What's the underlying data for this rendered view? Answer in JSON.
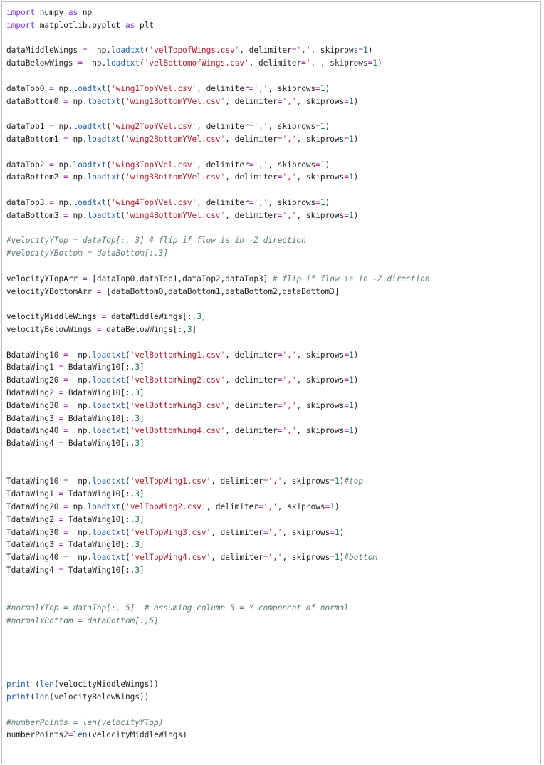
{
  "cell": {
    "lines": [
      "import numpy as np",
      "import matplotlib.pyplot as plt",
      "",
      "dataMiddleWings =  np.loadtxt('velTopofWings.csv', delimiter=',', skiprows=1)",
      "dataBelowWings =  np.loadtxt('velBottomofWings.csv', delimiter=',', skiprows=1)",
      "",
      "dataTop0 = np.loadtxt('wing1TopYVel.csv', delimiter=',', skiprows=1)",
      "dataBottom0 = np.loadtxt('wing1BottomYVel.csv', delimiter=',', skiprows=1)",
      "",
      "dataTop1 = np.loadtxt('wing2TopYVel.csv', delimiter=',', skiprows=1)",
      "dataBottom1 = np.loadtxt('wing2BottomYVel.csv', delimiter=',', skiprows=1)",
      "",
      "dataTop2 = np.loadtxt('wing3TopYVel.csv', delimiter=',', skiprows=1)",
      "dataBottom2 = np.loadtxt('wing3BottomYVel.csv', delimiter=',', skiprows=1)",
      "",
      "dataTop3 = np.loadtxt('wing4TopYVel.csv', delimiter=',', skiprows=1)",
      "dataBottom3 = np.loadtxt('wing4BottomYVel.csv', delimiter=',', skiprows=1)",
      "",
      "#velocityYTop = dataTop[:, 3] # flip if flow is in -Z direction",
      "#velocityYBottom = dataBottom[:,3]",
      "",
      "velocityYTopArr = [dataTop0,dataTop1,dataTop2,dataTop3] # flip if flow is in -Z direction",
      "velocityYBottomArr = [dataBottom0,dataBottom1,dataBottom2,dataBottom3]",
      "",
      "velocityMiddleWings = dataMiddleWings[:,3]",
      "velocityBelowWings = dataBelowWings[:,3]",
      "",
      "BdataWing10 =  np.loadtxt('velBottomWing1.csv', delimiter=',', skiprows=1)",
      "BdataWing1 = BdataWing10[:,3]",
      "BdataWing20 =  np.loadtxt('velBottomWing2.csv', delimiter=',', skiprows=1)",
      "BdataWing2 = BdataWing10[:,3]",
      "BdataWing30 =  np.loadtxt('velBottomWing3.csv', delimiter=',', skiprows=1)",
      "BdataWing3 = BdataWing10[:,3]",
      "BdataWing40 =  np.loadtxt('velBottomWing4.csv', delimiter=',', skiprows=1)",
      "BdataWing4 = BdataWing10[:,3]",
      "",
      "",
      "TdataWing10 =  np.loadtxt('velTopWing1.csv', delimiter=',', skiprows=1)#top",
      "TdataWing1 = TdataWing10[:,3]",
      "TdataWing20 = np.loadtxt('velTopWing2.csv', delimiter=',', skiprows=1)",
      "TdataWing2 = TdataWing10[:,3]",
      "TdataWing30 =  np.loadtxt('velTopWing3.csv', delimiter=',', skiprows=1)",
      "TdataWing3 = TdataWing10[:,3]",
      "TdataWing40 =  np.loadtxt('velTopWing4.csv', delimiter=',', skiprows=1)#bottom",
      "TdataWing4 = TdataWing10[:,3]",
      "",
      "",
      "#normalYTop = dataTop[:, 5]  # assuming column 5 = Y component of normal",
      "#normalYBottom = dataBottom[:,5]",
      "",
      "",
      "",
      "",
      "print (len(velocityMiddleWings))",
      "print(len(velocityBelowWings))",
      "",
      "#numberPoints = len(velocityYTop)",
      "numberPoints2=len(velocityMiddleWings)"
    ]
  }
}
